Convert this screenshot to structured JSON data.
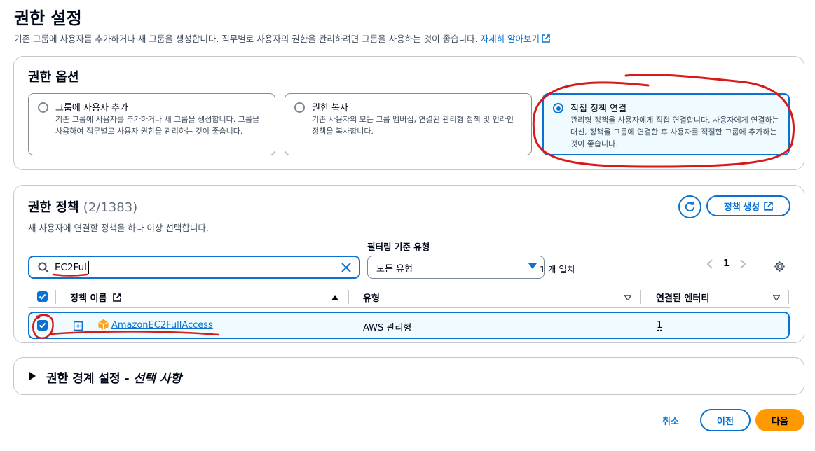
{
  "page": {
    "title": "권한 설정",
    "description": "기존 그룹에 사용자를 추가하거나 새 그룹을 생성합니다. 직무별로 사용자의 권한을 관리하려면 그룹을 사용하는 것이 좋습니다.",
    "learn_more": "자세히 알아보기"
  },
  "options_panel": {
    "title": "권한 옵션",
    "options": [
      {
        "title": "그룹에 사용자 추가",
        "desc": "기존 그룹에 사용자를 추가하거나 새 그룹을 생성합니다. 그룹을 사용하여 직무별로 사용자 권한을 관리하는 것이 좋습니다.",
        "selected": false
      },
      {
        "title": "권한 복사",
        "desc": "기존 사용자의 모든 그룹 멤버십, 연결된 관리형 정책 및 인라인 정책을 복사합니다.",
        "selected": false
      },
      {
        "title": "직접 정책 연결",
        "desc": "관리형 정책을 사용자에게 직접 연결합니다. 사용자에게 연결하는 대신, 정책을 그룹에 연결한 후 사용자를 적절한 그룹에 추가하는 것이 좋습니다.",
        "selected": true
      }
    ]
  },
  "policies_panel": {
    "title": "권한 정책",
    "count": "(2/1383)",
    "description": "새 사용자에 연결할 정책을 하나 이상 선택합니다.",
    "create_policy": "정책 생성",
    "filter_label": "필터링 기준 유형",
    "search_value": "EC2Full",
    "type_select": "모든 유형",
    "match_count": "1 개 일치",
    "page_number": "1",
    "columns": {
      "name": "정책 이름",
      "type": "유형",
      "entities": "연결된 엔터티"
    },
    "rows": [
      {
        "name": "AmazonEC2FullAccess",
        "type": "AWS 관리형",
        "entities": "1",
        "checked": true
      }
    ]
  },
  "boundary_panel": {
    "title": "권한 경계 설정 - ",
    "title_italic": "선택 사항"
  },
  "footer": {
    "cancel": "취소",
    "previous": "이전",
    "next": "다음"
  },
  "colors": {
    "accent": "#0972d3",
    "primary_button": "#ff9900",
    "annotation": "#d91a1a"
  }
}
